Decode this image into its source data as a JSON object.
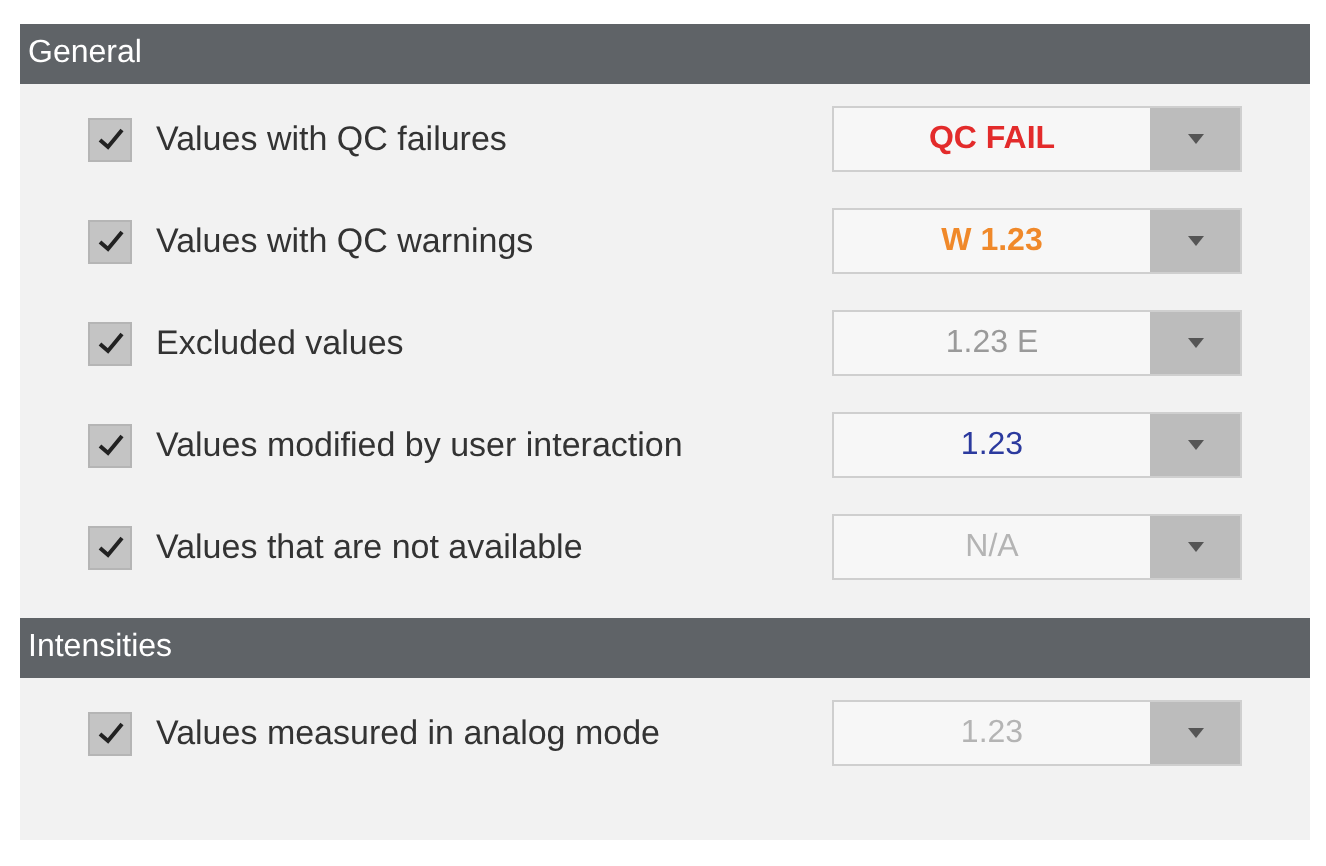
{
  "sections": [
    {
      "title": "General",
      "rows": [
        {
          "label": "Values with QC failures",
          "checked": true,
          "value": "QC FAIL",
          "kind": "fail"
        },
        {
          "label": "Values with QC warnings",
          "checked": true,
          "value": "W 1.23",
          "kind": "warning"
        },
        {
          "label": "Excluded values",
          "checked": true,
          "value": "1.23 E",
          "kind": "excluded"
        },
        {
          "label": "Values modified by user interaction",
          "checked": true,
          "value": "1.23",
          "kind": "modified"
        },
        {
          "label": "Values that are not available",
          "checked": true,
          "value": "N/A",
          "kind": "unavailable"
        }
      ]
    },
    {
      "title": "Intensities",
      "rows": [
        {
          "label": "Values measured in analog mode",
          "checked": true,
          "value": "1.23",
          "kind": "unavailable"
        }
      ]
    }
  ]
}
